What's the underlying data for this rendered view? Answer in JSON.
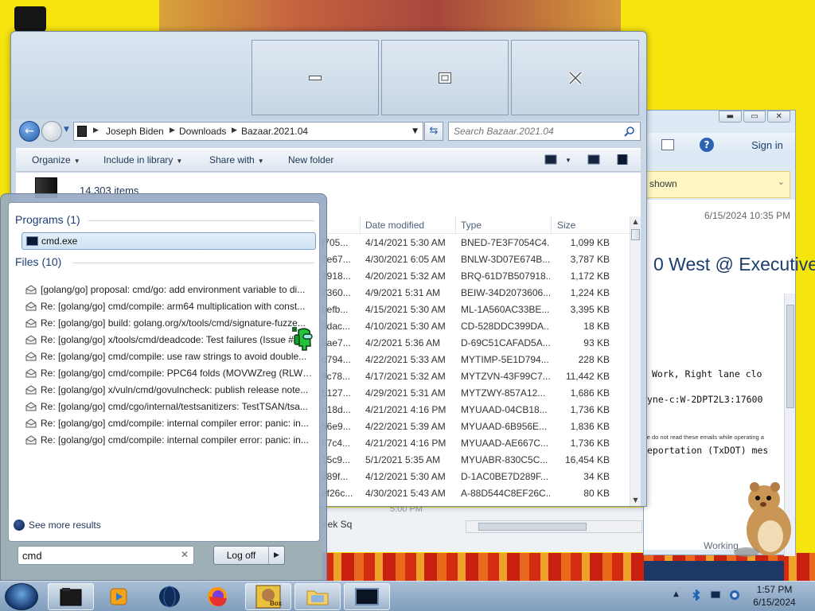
{
  "explorer": {
    "breadcrumbs": [
      "Joseph Biden",
      "Downloads",
      "Bazaar.2021.04"
    ],
    "search_placeholder": "Search Bazaar.2021.04",
    "toolbar": {
      "organize": "Organize",
      "include_in_library": "Include in library",
      "share_with": "Share with",
      "new_folder": "New folder"
    },
    "item_count": "14,303 items",
    "columns": {
      "date_modified": "Date modified",
      "type": "Type",
      "size": "Size"
    },
    "rows": [
      {
        "name": "f705...",
        "date": "4/14/2021 5:30 AM",
        "type": "BNED-7E3F7054C4...",
        "size": "1,099 KB"
      },
      {
        "name": "7e67...",
        "date": "4/30/2021 6:05 AM",
        "type": "BNLW-3D07E674B...",
        "size": "3,787 KB"
      },
      {
        "name": "7918...",
        "date": "4/20/2021 5:32 AM",
        "type": "BRQ-61D7B507918...",
        "size": "1,172 KB"
      },
      {
        "name": "7360...",
        "date": "4/9/2021 5:31 AM",
        "type": "BEIW-34D2073606...",
        "size": "1,224 KB"
      },
      {
        "name": "befb...",
        "date": "4/15/2021 5:30 AM",
        "type": "ML-1A560AC33BE...",
        "size": "3,395 KB"
      },
      {
        "name": "9dac...",
        "date": "4/10/2021 5:30 AM",
        "type": "CD-528DDC399DA...",
        "size": "18 KB"
      },
      {
        "name": "5ae7...",
        "date": "4/2/2021 5:36 AM",
        "type": "D-69C51CAFAD5A...",
        "size": "93 KB"
      },
      {
        "name": "d794...",
        "date": "4/22/2021 5:33 AM",
        "type": "MYTIMP-5E1D794...",
        "size": "228 KB"
      },
      {
        "name": "9c78...",
        "date": "4/17/2021 5:32 AM",
        "type": "MYTZVN-43F99C7...",
        "size": "11,442 KB"
      },
      {
        "name": "b127...",
        "date": "4/29/2021 5:31 AM",
        "type": "MYTZWY-857A12...",
        "size": "1,686 KB"
      },
      {
        "name": "b18d...",
        "date": "4/21/2021 4:16 PM",
        "type": "MYUAAD-04CB18...",
        "size": "1,736 KB"
      },
      {
        "name": "56e9...",
        "date": "4/22/2021 5:39 AM",
        "type": "MYUAAD-6B956E...",
        "size": "1,836 KB"
      },
      {
        "name": "67c4...",
        "date": "4/21/2021 4:16 PM",
        "type": "MYUAAD-AE667C...",
        "size": "1,736 KB"
      },
      {
        "name": "15c9...",
        "date": "5/1/2021 5:35 AM",
        "type": "MYUABR-830C5C...",
        "size": "16,454 KB"
      },
      {
        "name": "289f...",
        "date": "4/12/2021 5:30 AM",
        "type": "D-1AC0BE7D289F...",
        "size": "34 KB"
      },
      {
        "name": "ef26c...",
        "date": "4/30/2021 5:43 AM",
        "type": "A-88D544C8EF26C...",
        "size": "80 KB"
      }
    ]
  },
  "start_menu": {
    "programs_header": "Programs (1)",
    "program": "cmd.exe",
    "files_header": "Files (10)",
    "files": [
      "[golang/go] proposal: cmd/go: add environment variable to di...",
      "Re: [golang/go] cmd/compile: arm64 multiplication with const...",
      "Re: [golang/go] build: golang.org/x/tools/cmd/signature-fuzze...",
      "Re: [golang/go] x/tools/cmd/deadcode: Test failures (Issue #...",
      "Re: [golang/go] cmd/compile: use raw strings to avoid double...",
      "Re: [golang/go] cmd/compile: PPC64 folds (MOVWZreg (RLWI...",
      "Re: [golang/go] x/vuln/cmd/govulncheck: publish release note...",
      "Re: [golang/go] cmd/cgo/internal/testsanitizers: TestTSAN/tsa...",
      "Re: [golang/go] cmd/compile: internal compiler error: panic: in...",
      "Re: [golang/go] cmd/compile: internal compiler error: panic: in..."
    ],
    "see_more": "See more results",
    "search_value": "cmd",
    "log_off": "Log off"
  },
  "outlook": {
    "sign_in": "Sign in",
    "infobar": "shown",
    "date": "6/15/2024 10:35 PM",
    "subject": "0 West @ Executive",
    "small_note": "se do not read these emails while operating a",
    "line1": "Work, Right lane clo",
    "line2": "yne-c:W-2DPT2L3:17600",
    "line3": "eportation (TxDOT) mes",
    "status": "Working"
  },
  "strip": {
    "week_label": "eek Sq",
    "time_label": "5:00 PM"
  },
  "taskbar": {
    "time": "1:57 PM",
    "date": "6/15/2024",
    "box_label": "Box"
  },
  "colors": {
    "accent": "#2b5fa6",
    "selection": "#cfe2f4",
    "wallpaper": "#f6e40e"
  }
}
